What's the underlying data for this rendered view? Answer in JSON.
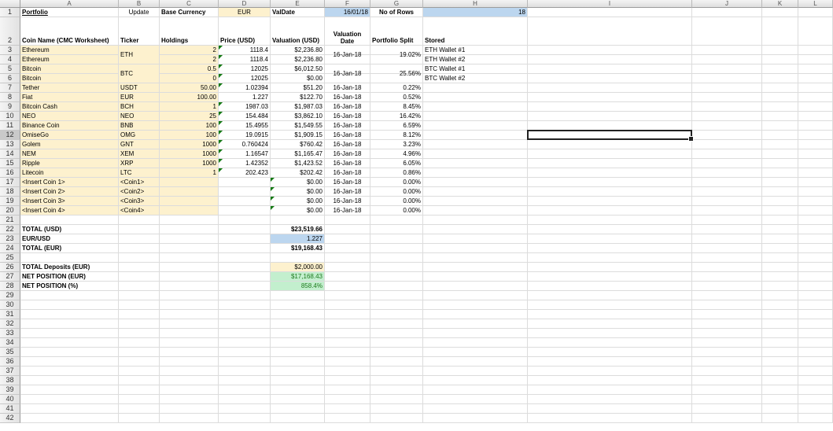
{
  "columns": [
    "A",
    "B",
    "C",
    "D",
    "E",
    "F",
    "G",
    "H",
    "I",
    "J",
    "K",
    "L"
  ],
  "colors": {
    "input_yellow": "#fdf1ce",
    "blue": "#bcd6ef",
    "green": "#c3efce",
    "green_text": "#1d7a1d",
    "header_bg": "#e8e8e8"
  },
  "header_row": {
    "portfolio": "Portfolio",
    "update": "Update",
    "base_currency_label": "Base Currency",
    "base_currency": "EUR",
    "valdate_label": "ValDate",
    "valdate": "16/01/18",
    "no_of_rows_label": "No of Rows",
    "no_of_rows": "18"
  },
  "table_headers": {
    "coin_name": "Coin Name (CMC Worksheet)",
    "ticker": "Ticker",
    "holdings": "Holdings",
    "price": "Price (USD)",
    "valuation": "Valuation (USD)",
    "valuation_date": "Valuation Date",
    "portfolio_split": "Portfolio Split",
    "stored": "Stored"
  },
  "rows": [
    {
      "name": "Ethereum",
      "ticker": "",
      "holdings": "2",
      "price": "1118.4",
      "valuation": "$2,236.80",
      "date": "",
      "split": "",
      "stored": "ETH Wallet #1",
      "flag": true
    },
    {
      "name": "Ethereum",
      "ticker": "",
      "holdings": "2",
      "price": "1118.4",
      "valuation": "$2,236.80",
      "date": "",
      "split": "",
      "stored": "ETH Wallet #2",
      "flag": true
    },
    {
      "name": "Bitcoin",
      "ticker": "",
      "holdings": "0.5",
      "price": "12025",
      "valuation": "$6,012.50",
      "date": "",
      "split": "",
      "stored": "BTC Wallet #1",
      "flag": true
    },
    {
      "name": "Bitcoin",
      "ticker": "",
      "holdings": "0",
      "price": "12025",
      "valuation": "$0.00",
      "date": "",
      "split": "",
      "stored": "BTC Wallet #2",
      "flag": true
    },
    {
      "name": "Tether",
      "ticker": "USDT",
      "holdings": "50.00",
      "price": "1.02394",
      "valuation": "$51.20",
      "date": "16-Jan-18",
      "split": "0.22%",
      "stored": "",
      "flag": true
    },
    {
      "name": "Fiat",
      "ticker": "EUR",
      "holdings": "100.00",
      "price": "1.227",
      "valuation": "$122.70",
      "date": "16-Jan-18",
      "split": "0.52%",
      "stored": "",
      "flag": false
    },
    {
      "name": "Bitcoin Cash",
      "ticker": "BCH",
      "holdings": "1",
      "price": "1987.03",
      "valuation": "$1,987.03",
      "date": "16-Jan-18",
      "split": "8.45%",
      "stored": "",
      "flag": true
    },
    {
      "name": "NEO",
      "ticker": "NEO",
      "holdings": "25",
      "price": "154.484",
      "valuation": "$3,862.10",
      "date": "16-Jan-18",
      "split": "16.42%",
      "stored": "",
      "flag": true
    },
    {
      "name": "Binance Coin",
      "ticker": "BNB",
      "holdings": "100",
      "price": "15.4955",
      "valuation": "$1,549.55",
      "date": "16-Jan-18",
      "split": "6.59%",
      "stored": "",
      "flag": true
    },
    {
      "name": "OmiseGo",
      "ticker": "OMG",
      "holdings": "100",
      "price": "19.0915",
      "valuation": "$1,909.15",
      "date": "16-Jan-18",
      "split": "8.12%",
      "stored": "",
      "flag": true
    },
    {
      "name": "Golem",
      "ticker": "GNT",
      "holdings": "1000",
      "price": "0.760424",
      "valuation": "$760.42",
      "date": "16-Jan-18",
      "split": "3.23%",
      "stored": "",
      "flag": true
    },
    {
      "name": "NEM",
      "ticker": "XEM",
      "holdings": "1000",
      "price": "1.16547",
      "valuation": "$1,165.47",
      "date": "16-Jan-18",
      "split": "4.96%",
      "stored": "",
      "flag": true
    },
    {
      "name": "Ripple",
      "ticker": "XRP",
      "holdings": "1000",
      "price": "1.42352",
      "valuation": "$1,423.52",
      "date": "16-Jan-18",
      "split": "6.05%",
      "stored": "",
      "flag": true
    },
    {
      "name": "Litecoin",
      "ticker": "LTC",
      "holdings": "1",
      "price": "202.423",
      "valuation": "$202.42",
      "date": "16-Jan-18",
      "split": "0.86%",
      "stored": "",
      "flag": true
    },
    {
      "name": "<Insert Coin 1>",
      "ticker": "<Coin1>",
      "holdings": "",
      "price": "",
      "valuation": "$0.00",
      "date": "16-Jan-18",
      "split": "0.00%",
      "stored": "",
      "flag": false
    },
    {
      "name": "<Insert Coin 2>",
      "ticker": "<Coin2>",
      "holdings": "",
      "price": "",
      "valuation": "$0.00",
      "date": "16-Jan-18",
      "split": "0.00%",
      "stored": "",
      "flag": false
    },
    {
      "name": "<Insert Coin 3>",
      "ticker": "<Coin3>",
      "holdings": "",
      "price": "",
      "valuation": "$0.00",
      "date": "16-Jan-18",
      "split": "0.00%",
      "stored": "",
      "flag": false
    },
    {
      "name": "<Insert Coin 4>",
      "ticker": "<Coin4>",
      "holdings": "",
      "price": "",
      "valuation": "$0.00",
      "date": "16-Jan-18",
      "split": "0.00%",
      "stored": "",
      "flag": false
    }
  ],
  "merged": {
    "eth": {
      "ticker": "ETH",
      "date": "16-Jan-18",
      "split": "19.02%"
    },
    "btc": {
      "ticker": "BTC",
      "date": "16-Jan-18",
      "split": "25.56%"
    }
  },
  "totals": {
    "total_usd_label": "TOTAL (USD)",
    "total_usd": "$23,519.66",
    "eurusd_label": "EUR/USD",
    "eurusd": "1.227",
    "total_eur_label": "TOTAL (EUR)",
    "total_eur": "$19,168.43",
    "deposits_label": "TOTAL Deposits (EUR)",
    "deposits": "$2,000.00",
    "net_eur_label": "NET POSITION (EUR)",
    "net_eur": "$17,168.43",
    "net_pct_label": "NET POSITION (%)",
    "net_pct": "858.4%"
  },
  "row_numbers": [
    "1",
    "2",
    "3",
    "4",
    "5",
    "6",
    "7",
    "8",
    "9",
    "10",
    "11",
    "12",
    "13",
    "14",
    "15",
    "16",
    "17",
    "18",
    "19",
    "20",
    "21",
    "22",
    "23",
    "24",
    "25",
    "26",
    "27",
    "28",
    "29",
    "30",
    "31",
    "32",
    "33",
    "34",
    "35",
    "36",
    "37",
    "38",
    "39",
    "40",
    "41",
    "42"
  ],
  "selected_row": "12",
  "selected_cell": "I12"
}
